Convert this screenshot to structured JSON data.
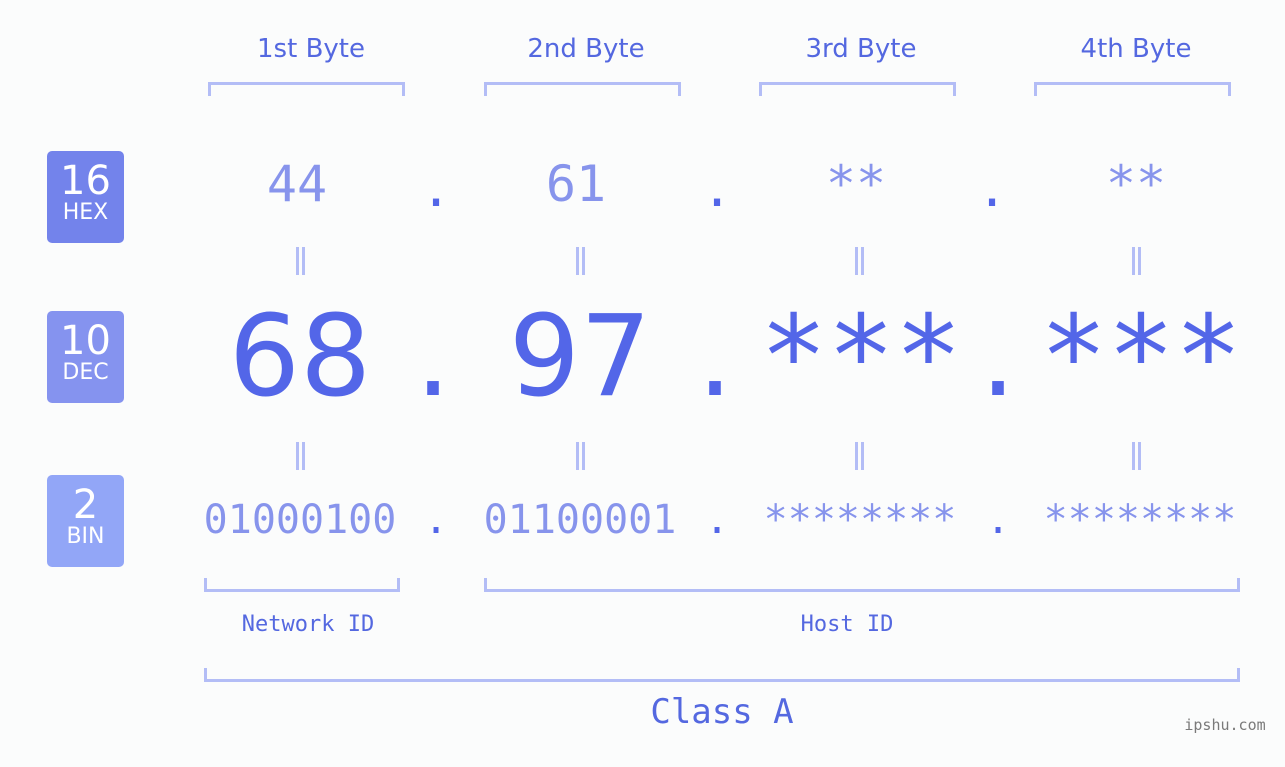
{
  "badges": [
    {
      "num": "16",
      "label": "HEX",
      "color": "#7383eb"
    },
    {
      "num": "10",
      "label": "DEC",
      "color": "#8593ef"
    },
    {
      "num": "2",
      "label": "BIN",
      "color": "#92a6f7"
    }
  ],
  "byte_headers": [
    "1st Byte",
    "2nd Byte",
    "3rd Byte",
    "4th Byte"
  ],
  "hex": [
    "44",
    "61",
    "**",
    "**"
  ],
  "dec": [
    "68",
    "97",
    "***",
    "***"
  ],
  "bin": [
    "01000100",
    "01100001",
    "********",
    "********"
  ],
  "separator": ".",
  "network_id": "Network ID",
  "host_id": "Host ID",
  "class_label": "Class A",
  "watermark": "ipshu.com"
}
